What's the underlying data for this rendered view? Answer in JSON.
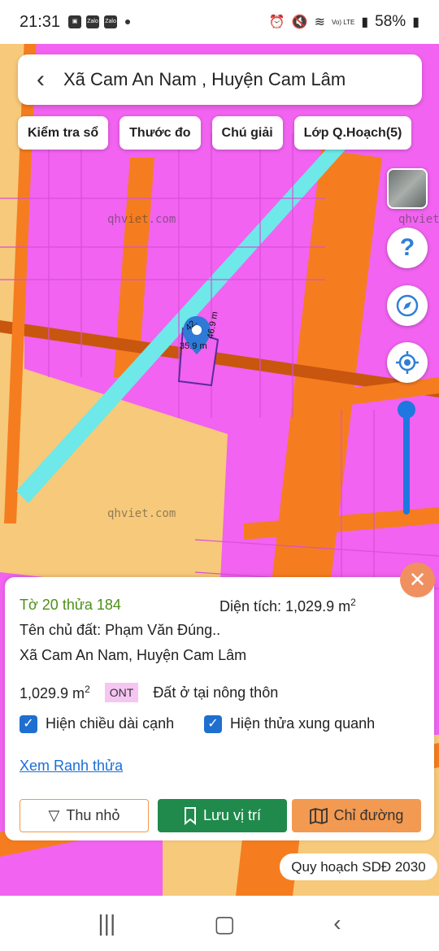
{
  "status_bar": {
    "time": "21:31",
    "notification_icons": [
      "gallery-icon",
      "zalo-icon",
      "zalo-icon"
    ],
    "battery": "58%",
    "network": "Vo) LTE"
  },
  "header": {
    "title": "Xã Cam An Nam , Huyện Cam Lâm"
  },
  "toolbar": {
    "chips": [
      "Kiểm tra sổ",
      "Thước đo",
      "Chú giải",
      "Lớp Q.Hoạch(5)"
    ]
  },
  "map": {
    "watermark": "qhviet.com",
    "parcel_edges": [
      "42.",
      "46.9 m",
      "35.9 m"
    ],
    "colors": {
      "residential": "#f163f0",
      "road": "#f57d1f",
      "agri": "#f7c97a",
      "river": "#6ee8e8"
    }
  },
  "info_panel": {
    "parcel_id": "Tờ 20 thửa 184",
    "area_label": "Diện tích: 1,029.9 m",
    "area_sup": "2",
    "owner": "Tên chủ đất: Phạm Văn Đúng..",
    "location": "Xã Cam An Nam, Huyện Cam Lâm",
    "zone_area": "1,029.9 m",
    "zone_sup": "2",
    "zone_code": "ONT",
    "zone_name": "Đất ở tại nông thôn",
    "checkbox_edges": "Hiện chiều dài cạnh",
    "checkbox_neighbors": "Hiện thửa xung quanh",
    "view_boundary": "Xem Ranh thửa",
    "shrink_label": "Thu nhỏ",
    "save_label": "Lưu vị trí",
    "route_label": "Chỉ đường"
  },
  "plan_badge": "Quy hoạch SDĐ 2030"
}
